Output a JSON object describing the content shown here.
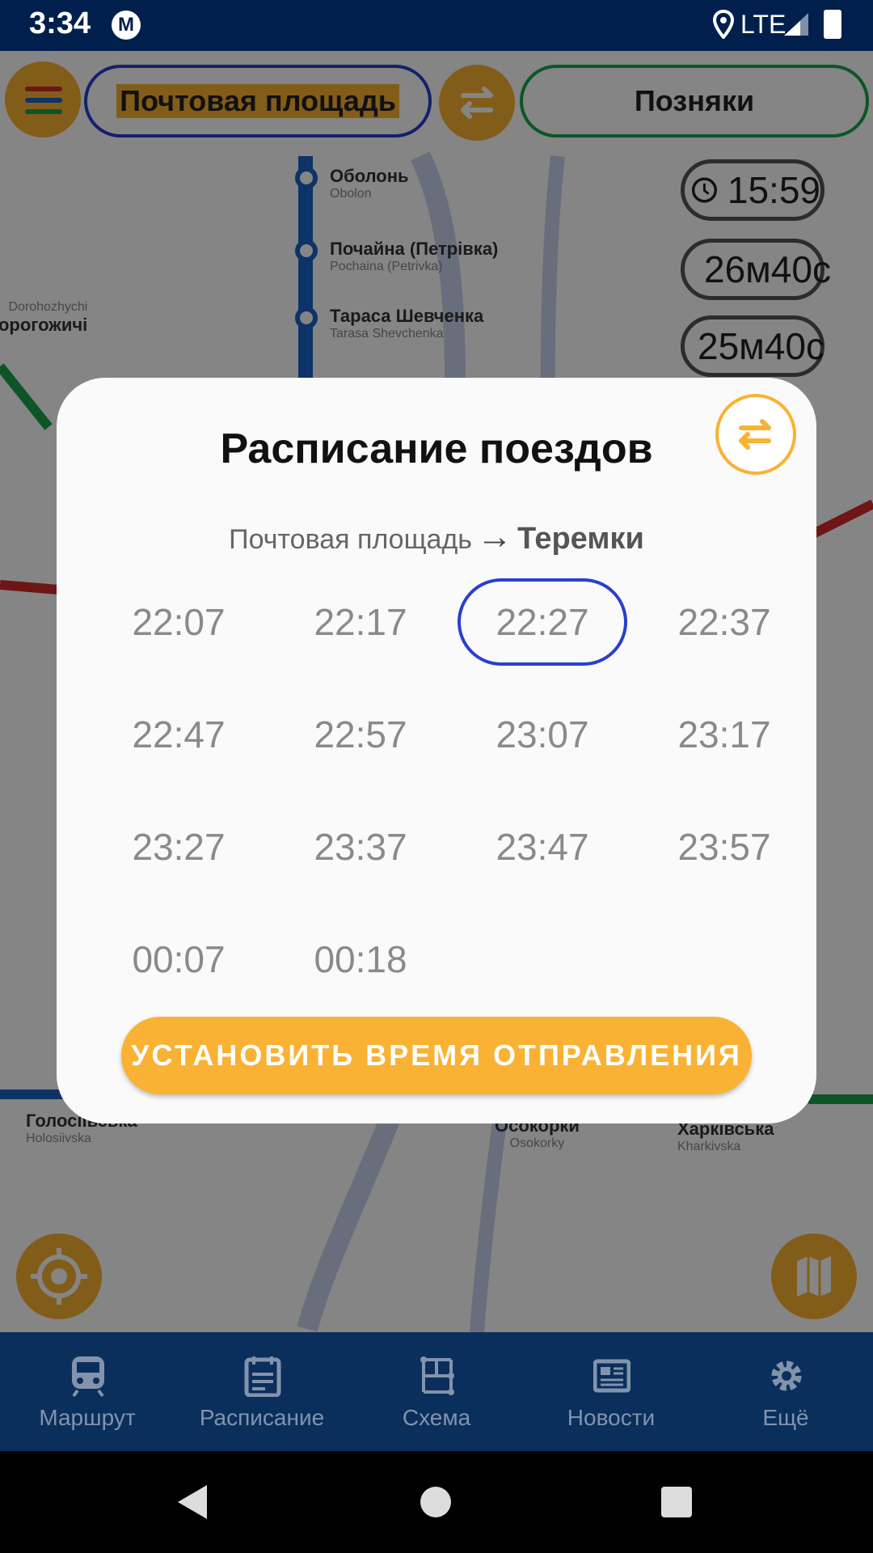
{
  "status_bar": {
    "time": "3:34",
    "network": "LTE",
    "app_logo_letter": "M"
  },
  "route_fields": {
    "from": "Почтовая площадь",
    "to": "Позняки"
  },
  "info_pills": {
    "clock_time": "15:59",
    "travel_time": "26м40с",
    "train_time": "25м40с"
  },
  "map": {
    "stations": [
      {
        "name": "Оболонь",
        "sub": "Obolon"
      },
      {
        "name": "Почайна (Петрівка)",
        "sub": "Pochaina (Petrivka)"
      },
      {
        "name": "Тараса Шевченка",
        "sub": "Tarasa Shevchenka"
      },
      {
        "name": "Дорогожичі",
        "sub": "Dorohozhychi"
      },
      {
        "name": "Голосіївська",
        "sub": "Holosiivska"
      },
      {
        "name": "Осокорки",
        "sub": "Osokorky"
      },
      {
        "name": "Харківська",
        "sub": "Kharkivska"
      }
    ]
  },
  "dialog": {
    "title": "Расписание поездов",
    "route_from": "Почтовая площадь",
    "route_to": "Теремки",
    "times": [
      "22:07",
      "22:17",
      "22:27",
      "22:37",
      "22:47",
      "22:57",
      "23:07",
      "23:17",
      "23:27",
      "23:37",
      "23:47",
      "23:57",
      "00:07",
      "00:18"
    ],
    "selected_index": 2,
    "set_button": "УСТАНОВИТЬ ВРЕМЯ ОТПРАВЛЕНИЯ"
  },
  "bottom_nav": [
    {
      "label": "Маршрут",
      "icon": "train-icon"
    },
    {
      "label": "Расписание",
      "icon": "calendar-icon"
    },
    {
      "label": "Схема",
      "icon": "scheme-icon"
    },
    {
      "label": "Новости",
      "icon": "news-icon"
    },
    {
      "label": "Ещё",
      "icon": "gear-icon"
    }
  ],
  "colors": {
    "accent": "#f9b233",
    "blue": "#2a3fcf",
    "green": "#1aa34a",
    "nav_bg": "#0a2f5c"
  }
}
